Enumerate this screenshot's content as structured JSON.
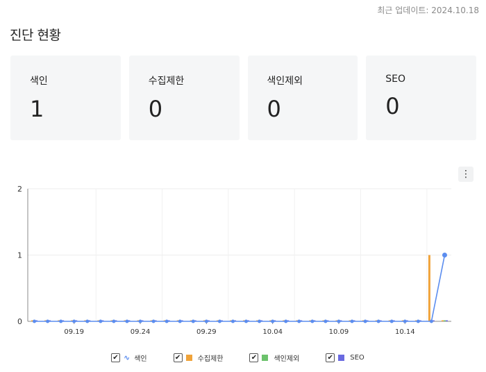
{
  "header": {
    "updated": "최근 업데이트: 2024.10.18",
    "title": "진단 현황"
  },
  "cards": [
    {
      "label": "색인",
      "value": "1"
    },
    {
      "label": "수집제한",
      "value": "0"
    },
    {
      "label": "색인제외",
      "value": "0"
    },
    {
      "label": "SEO",
      "value": "0"
    }
  ],
  "menu_icon": "more-vertical-icon",
  "legend": [
    {
      "label": "색인",
      "color": "#5b8def",
      "icon": "wave-icon"
    },
    {
      "label": "수집제한",
      "color": "#f0a33a"
    },
    {
      "label": "색인제외",
      "color": "#6cc26c"
    },
    {
      "label": "SEO",
      "color": "#6a6ae0"
    }
  ],
  "chart_data": {
    "type": "bar+line",
    "x": [
      "09.16",
      "09.17",
      "09.18",
      "09.19",
      "09.20",
      "09.21",
      "09.22",
      "09.23",
      "09.24",
      "09.25",
      "09.26",
      "09.27",
      "09.28",
      "09.29",
      "09.30",
      "10.01",
      "10.02",
      "10.03",
      "10.04",
      "10.05",
      "10.06",
      "10.07",
      "10.08",
      "10.09",
      "10.10",
      "10.11",
      "10.12",
      "10.13",
      "10.14",
      "10.15",
      "10.16",
      "10.17"
    ],
    "xticks": [
      "09.19",
      "09.24",
      "09.29",
      "10.04",
      "10.09",
      "10.14"
    ],
    "ylim": [
      0,
      2
    ],
    "yticks": [
      "0",
      "1",
      "2"
    ],
    "series": [
      {
        "name": "색인",
        "kind": "line",
        "color": "#5b8def",
        "values": [
          0,
          0,
          0,
          0,
          0,
          0,
          0,
          0,
          0,
          0,
          0,
          0,
          0,
          0,
          0,
          0,
          0,
          0,
          0,
          0,
          0,
          0,
          0,
          0,
          0,
          0,
          0,
          0,
          0,
          0,
          0,
          1
        ]
      },
      {
        "name": "수집제한",
        "kind": "bar",
        "color": "#f0a33a",
        "values": [
          0,
          0,
          0,
          0,
          0,
          0,
          0,
          0,
          0,
          0,
          0,
          0,
          0,
          0,
          0,
          0,
          0,
          0,
          0,
          0,
          0,
          0,
          0,
          0,
          0,
          0,
          0,
          0,
          0,
          0,
          1,
          0
        ]
      },
      {
        "name": "색인제외",
        "kind": "bar",
        "color": "#6cc26c",
        "values": [
          0,
          0,
          0,
          0,
          0,
          0,
          0,
          0,
          0,
          0,
          0,
          0,
          0,
          0,
          0,
          0,
          0,
          0,
          0,
          0,
          0,
          0,
          0,
          0,
          0,
          0,
          0,
          0,
          0,
          0,
          0,
          0
        ]
      },
      {
        "name": "SEO",
        "kind": "bar",
        "color": "#6a6ae0",
        "values": [
          0,
          0,
          0,
          0,
          0,
          0,
          0,
          0,
          0,
          0,
          0,
          0,
          0,
          0,
          0,
          0,
          0,
          0,
          0,
          0,
          0,
          0,
          0,
          0,
          0,
          0,
          0,
          0,
          0,
          0,
          0,
          0
        ]
      }
    ]
  }
}
